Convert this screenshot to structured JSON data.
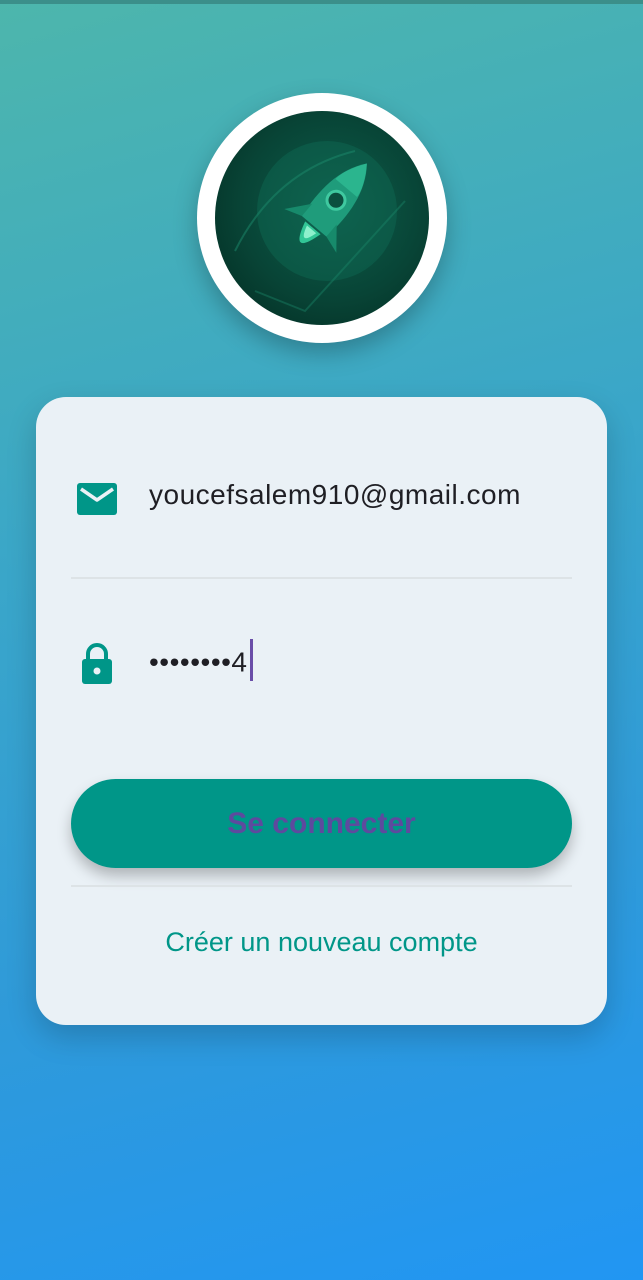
{
  "login": {
    "email_value": "youcefsalem910@gmail.com",
    "password_value": "••••••••4",
    "submit_label": "Se connecter",
    "create_account_label": "Créer un nouveau compte"
  },
  "icons": {
    "logo": "rocket-logo",
    "email": "mail-icon",
    "password": "lock-icon"
  },
  "colors": {
    "primary": "#009688",
    "button_text": "#5e4a9e",
    "caret": "#6a4ea8",
    "card_background": "#eaf1f6"
  }
}
